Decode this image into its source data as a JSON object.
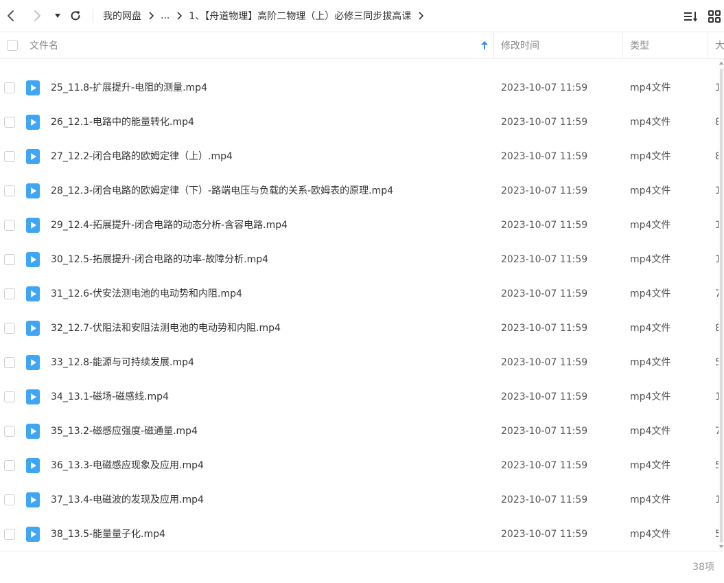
{
  "nav": {
    "breadcrumb": [
      "我的网盘",
      "...",
      "1、【舟道物理】高阶二物理（上）必修三同步拔高课"
    ]
  },
  "columns": {
    "name": "文件名",
    "modified": "修改时间",
    "type": "类型",
    "size": "大"
  },
  "files": [
    {
      "name": "25_11.8-扩展提升-电阻的测量.mp4",
      "modified": "2023-10-07 11:59",
      "type": "mp4文件",
      "size": "1"
    },
    {
      "name": "26_12.1-电路中的能量转化.mp4",
      "modified": "2023-10-07 11:59",
      "type": "mp4文件",
      "size": "8"
    },
    {
      "name": "27_12.2-闭合电路的欧姆定律（上）.mp4",
      "modified": "2023-10-07 11:59",
      "type": "mp4文件",
      "size": "8"
    },
    {
      "name": "28_12.3-闭合电路的欧姆定律（下）-路端电压与负载的关系-欧姆表的原理.mp4",
      "modified": "2023-10-07 11:59",
      "type": "mp4文件",
      "size": "1"
    },
    {
      "name": "29_12.4-拓展提升-闭合电路的动态分析-含容电路.mp4",
      "modified": "2023-10-07 11:59",
      "type": "mp4文件",
      "size": "1"
    },
    {
      "name": "30_12.5-拓展提升-闭合电路的功率-故障分析.mp4",
      "modified": "2023-10-07 11:59",
      "type": "mp4文件",
      "size": "1"
    },
    {
      "name": "31_12.6-伏安法测电池的电动势和内阻.mp4",
      "modified": "2023-10-07 11:59",
      "type": "mp4文件",
      "size": "7"
    },
    {
      "name": "32_12.7-伏阻法和安阻法测电池的电动势和内阻.mp4",
      "modified": "2023-10-07 11:59",
      "type": "mp4文件",
      "size": "8"
    },
    {
      "name": "33_12.8-能源与可持续发展.mp4",
      "modified": "2023-10-07 11:59",
      "type": "mp4文件",
      "size": "5"
    },
    {
      "name": "34_13.1-磁场-磁感线.mp4",
      "modified": "2023-10-07 11:59",
      "type": "mp4文件",
      "size": "1"
    },
    {
      "name": "35_13.2-磁感应强度-磁通量.mp4",
      "modified": "2023-10-07 11:59",
      "type": "mp4文件",
      "size": "7"
    },
    {
      "name": "36_13.3-电磁感应现象及应用.mp4",
      "modified": "2023-10-07 11:59",
      "type": "mp4文件",
      "size": "5"
    },
    {
      "name": "37_13.4-电磁波的发现及应用.mp4",
      "modified": "2023-10-07 11:59",
      "type": "mp4文件",
      "size": "1"
    },
    {
      "name": "38_13.5-能量量子化.mp4",
      "modified": "2023-10-07 11:59",
      "type": "mp4文件",
      "size": "5"
    }
  ],
  "footer": {
    "item_count": "38项"
  },
  "colors": {
    "accent": "#2c8cf4",
    "file_icon": "#3ea6f5"
  },
  "icons": {
    "back": "chevron-left-icon",
    "forward": "chevron-right-icon",
    "history": "caret-down-icon",
    "refresh": "refresh-icon",
    "sort": "sort-list-icon",
    "view": "grid-view-icon",
    "file": "video-file-icon"
  }
}
